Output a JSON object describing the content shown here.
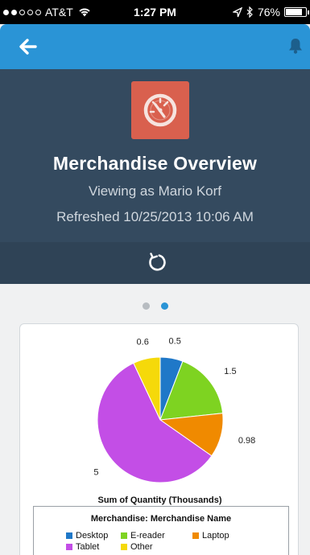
{
  "status_bar": {
    "carrier": "AT&T",
    "time": "1:27 PM",
    "battery": "76%",
    "battery_level": 0.76,
    "signal_bars": 2
  },
  "nav": {
    "back_icon": "arrow-left-icon",
    "notification_icon": "bell-icon"
  },
  "header": {
    "icon": "speedometer-icon",
    "title": "Merchandise Overview",
    "viewing_as": "Viewing as Mario Korf",
    "refreshed": "Refreshed 10/25/2013 10:06 AM",
    "refresh_icon": "refresh-icon",
    "colors": {
      "background": "#344a5f",
      "icon_tile": "#d9604e",
      "nav": "#2a94d6"
    }
  },
  "pager": {
    "pages": 2,
    "active_index": 1
  },
  "chart_data": {
    "type": "pie",
    "title": "Sum of Quantity (Thousands)",
    "legend_title": "Merchandise: Merchandise Name",
    "legend_position": "bottom",
    "slices": [
      {
        "name": "Desktop",
        "value": 0.5,
        "label": "0.5",
        "color": "#1f78c8"
      },
      {
        "name": "E-reader",
        "value": 1.5,
        "label": "1.5",
        "color": "#7ed321"
      },
      {
        "name": "Laptop",
        "value": 0.98,
        "label": "0.98",
        "color": "#f08a00"
      },
      {
        "name": "Tablet",
        "value": 5,
        "label": "5",
        "color": "#c34ee6"
      },
      {
        "name": "Other",
        "value": 0.6,
        "label": "0.6",
        "color": "#f5d90a"
      }
    ]
  }
}
